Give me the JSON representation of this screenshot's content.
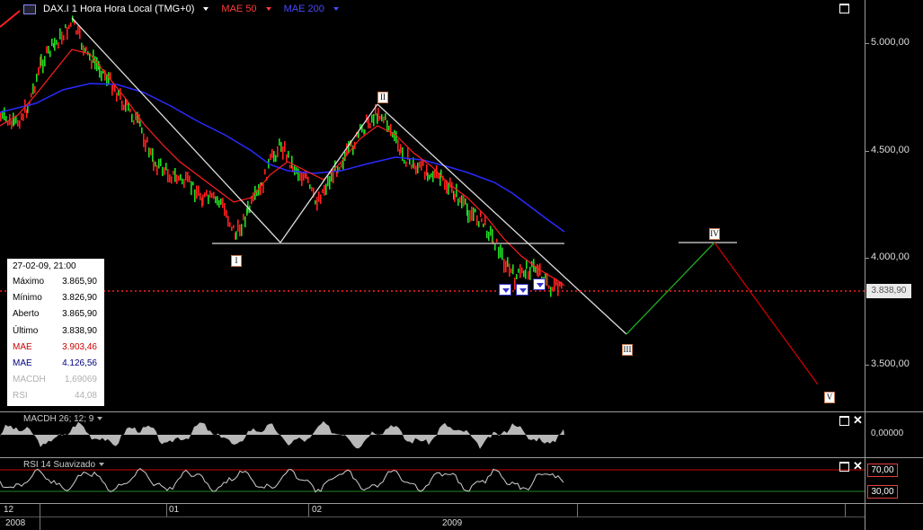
{
  "header": {
    "instrument": "DAX.I 1 Hora Hora Local (TMG+0)",
    "mae50": "MAE 50",
    "mae200": "MAE 200"
  },
  "info_box": {
    "datetime": "27-02-09, 21:00",
    "rows": [
      {
        "label": "Máximo",
        "value": "3.865,90",
        "color": "#000000"
      },
      {
        "label": "Mínimo",
        "value": "3.826,90",
        "color": "#000000"
      },
      {
        "label": "Aberto",
        "value": "3.865,90",
        "color": "#000000"
      },
      {
        "label": "Último",
        "value": "3.838,90",
        "color": "#000000"
      },
      {
        "label": "MAE",
        "value": "3.903,46",
        "color": "#cc0000"
      },
      {
        "label": "MAE",
        "value": "4.126,56",
        "color": "#000080"
      },
      {
        "label": "MACDH",
        "value": "1,69069",
        "color": "#b0b0b0"
      },
      {
        "label": "RSI",
        "value": "44,08",
        "color": "#b0b0b0"
      }
    ]
  },
  "price_axis": {
    "labels": [
      "5.000,00",
      "4.500,00",
      "4.000,00",
      "3.500,00"
    ],
    "current_price": "3.838,90"
  },
  "waves": {
    "w1": "I",
    "w2": "II",
    "w3": "III",
    "w4": "IV",
    "w5": "V"
  },
  "macd_panel": {
    "title": "MACDH 26; 12; 9",
    "zero_label": "0,00000"
  },
  "rsi_panel": {
    "title": "RSI 14 Suavizado",
    "upper": "70,00",
    "lower": "30,00"
  },
  "timeline": {
    "labels_top": [
      "12",
      "01",
      "02"
    ],
    "labels_bottom": [
      "2008",
      "2009"
    ]
  },
  "colors": {
    "mae50": "#ff2020",
    "mae200": "#2a2aff",
    "bull": "#22dd22",
    "bear": "#ff2020",
    "projection_up": "#22aa22",
    "projection_down": "#cc0000"
  }
}
